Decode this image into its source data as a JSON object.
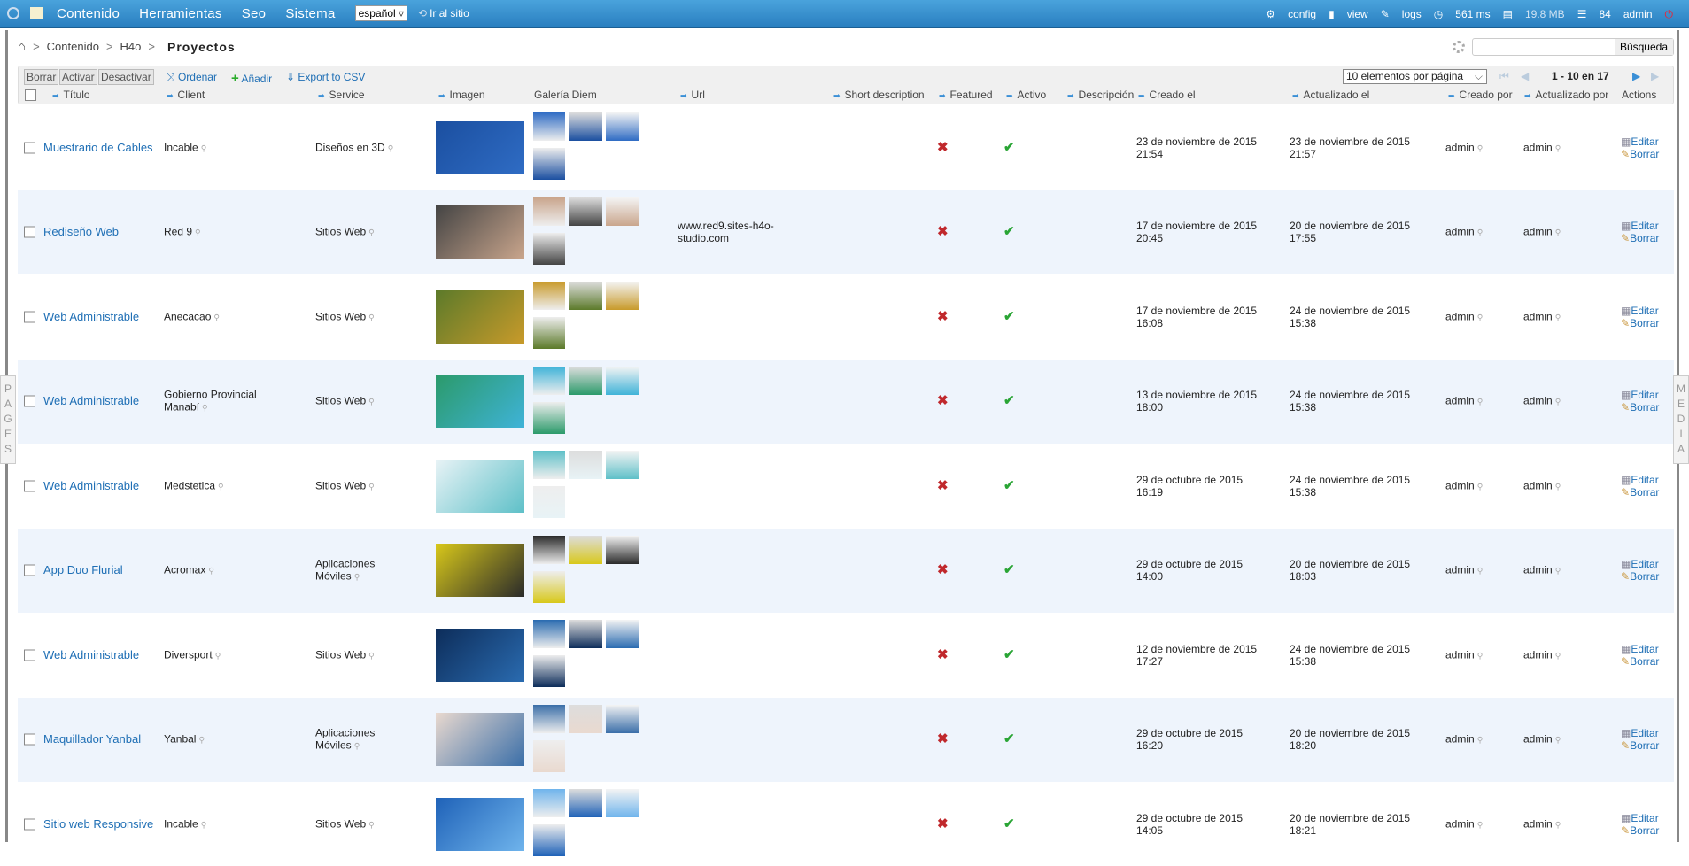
{
  "topbar": {
    "nav": [
      "Contenido",
      "Herramientas",
      "Seo",
      "Sistema"
    ],
    "language": "español",
    "visit_site": "Ir al sitio",
    "config": "config",
    "view": "view",
    "logs": "logs",
    "time": "561 ms",
    "memory": "19.8 MB",
    "queries": "84",
    "user": "admin"
  },
  "breadcrumb": {
    "items": [
      "Contenido",
      "H4o"
    ],
    "current": "Proyectos",
    "separator": ">"
  },
  "search": {
    "button": "Búsqueda",
    "value": ""
  },
  "toolbar": {
    "delete": "Borrar",
    "activate": "Activar",
    "deactivate": "Desactivar",
    "sort": "Ordenar",
    "add": "Añadir",
    "export": "Export to CSV",
    "per_page": "10 elementos por página",
    "pagination": "1 - 10 en 17"
  },
  "columns": [
    "Título",
    "Client",
    "Service",
    "Imagen",
    "Galería Diem",
    "Url",
    "Short description",
    "Featured",
    "Activo",
    "Descripción",
    "Creado el",
    "Actualizado el",
    "Creado por",
    "Actualizado por",
    "Actions"
  ],
  "actions": {
    "edit": "Editar",
    "delete": "Borrar"
  },
  "side_tabs": {
    "left": "PAGES",
    "right": "MEDIA"
  },
  "rows": [
    {
      "title": "Muestrario de Cables",
      "client": "Incable",
      "service": "Diseños en 3D",
      "url": "",
      "featured": false,
      "active": true,
      "created": "23 de noviembre de 2015 21:54",
      "updated": "23 de noviembre de 2015 21:57",
      "created_by": "admin",
      "updated_by": "admin",
      "img": [
        "#1b4fa0",
        "#2f6cc4"
      ]
    },
    {
      "title": "Rediseño Web",
      "client": "Red 9",
      "service": "Sitios Web",
      "url": "www.red9.sites-h4o-studio.com",
      "featured": false,
      "active": true,
      "created": "17 de noviembre de 2015 20:45",
      "updated": "20 de noviembre de 2015 17:55",
      "created_by": "admin",
      "updated_by": "admin",
      "img": [
        "#444",
        "#c9a58c"
      ]
    },
    {
      "title": "Web Administrable",
      "client": "Anecacao",
      "service": "Sitios Web",
      "url": "",
      "featured": false,
      "active": true,
      "created": "17 de noviembre de 2015 16:08",
      "updated": "24 de noviembre de 2015 15:38",
      "created_by": "admin",
      "updated_by": "admin",
      "img": [
        "#5c7a2a",
        "#c89a2a"
      ]
    },
    {
      "title": "Web Administrable",
      "client": "Gobierno Provincial Manabí",
      "service": "Sitios Web",
      "url": "",
      "featured": false,
      "active": true,
      "created": "13 de noviembre de 2015 18:00",
      "updated": "24 de noviembre de 2015 15:38",
      "created_by": "admin",
      "updated_by": "admin",
      "img": [
        "#2b9a6a",
        "#3fb3d8"
      ]
    },
    {
      "title": "Web Administrable",
      "client": "Medstetica",
      "service": "Sitios Web",
      "url": "",
      "featured": false,
      "active": true,
      "created": "29 de octubre de 2015 16:19",
      "updated": "24 de noviembre de 2015 15:38",
      "created_by": "admin",
      "updated_by": "admin",
      "img": [
        "#e8f3f6",
        "#5ec0c8"
      ]
    },
    {
      "title": "App Duo Flurial",
      "client": "Acromax",
      "service": "Aplicaciones Móviles",
      "url": "",
      "featured": false,
      "active": true,
      "created": "29 de octubre de 2015 14:00",
      "updated": "20 de noviembre de 2015 18:03",
      "created_by": "admin",
      "updated_by": "admin",
      "img": [
        "#d8c81a",
        "#2a2a2a"
      ]
    },
    {
      "title": "Web Administrable",
      "client": "Diversport",
      "service": "Sitios Web",
      "url": "",
      "featured": false,
      "active": true,
      "created": "12 de noviembre de 2015 17:27",
      "updated": "24 de noviembre de 2015 15:38",
      "created_by": "admin",
      "updated_by": "admin",
      "img": [
        "#0d2d5a",
        "#2a6bb0"
      ]
    },
    {
      "title": "Maquillador Yanbal",
      "client": "Yanbal",
      "service": "Aplicaciones Móviles",
      "url": "",
      "featured": false,
      "active": true,
      "created": "29 de octubre de 2015 16:20",
      "updated": "20 de noviembre de 2015 18:20",
      "created_by": "admin",
      "updated_by": "admin",
      "img": [
        "#e9d9cf",
        "#3a6ea8"
      ]
    },
    {
      "title": "Sitio web Responsive",
      "client": "Incable",
      "service": "Sitios Web",
      "url": "",
      "featured": false,
      "active": true,
      "created": "29 de octubre de 2015 14:05",
      "updated": "20 de noviembre de 2015 18:21",
      "created_by": "admin",
      "updated_by": "admin",
      "img": [
        "#1f62b8",
        "#6fb4ec"
      ]
    }
  ]
}
